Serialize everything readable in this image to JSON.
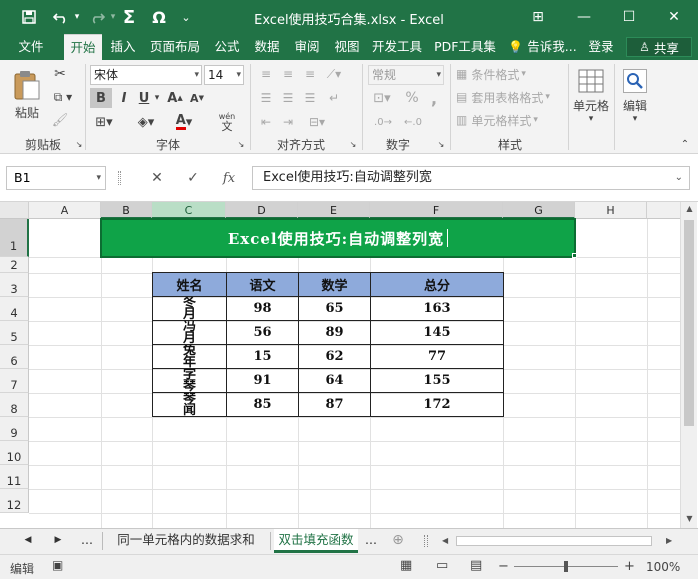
{
  "title_bar": {
    "title": "Excel使用技巧合集.xlsx - Excel",
    "save_icon": "save-icon",
    "undo_icon": "undo-icon",
    "redo_icon": "redo-icon",
    "sum_glyph": "Σ",
    "omega_glyph": "Ω",
    "customize_glyph": "⌄",
    "ribbon_display_glyph": "⊞",
    "minimize_glyph": "—",
    "maximize_glyph": "☐",
    "close_glyph": "✕"
  },
  "ribbon_tabs": [
    {
      "label": "文件"
    },
    {
      "label": "开始"
    },
    {
      "label": "插入"
    },
    {
      "label": "页面布局"
    },
    {
      "label": "公式"
    },
    {
      "label": "数据"
    },
    {
      "label": "审阅"
    },
    {
      "label": "视图"
    },
    {
      "label": "开发工具"
    },
    {
      "label": "PDF工具集"
    },
    {
      "label": "告诉我..."
    },
    {
      "label": "登录"
    },
    {
      "label": "共享"
    }
  ],
  "ribbon": {
    "clipboard": {
      "paste_label": "粘贴",
      "group_label": "剪贴板"
    },
    "font": {
      "font_name": "宋体",
      "font_size": "14",
      "bold": "B",
      "italic": "I",
      "underline": "U",
      "grow": "A",
      "shrink": "A",
      "color_a": "A",
      "wen": "wén",
      "wen_sub": "文",
      "group_label": "字体"
    },
    "alignment": {
      "group_label": "对齐方式"
    },
    "number": {
      "format": "常规",
      "currency": "%",
      "comma": ",",
      "group_label": "数字"
    },
    "styles": {
      "conditional": "条件格式",
      "table": "套用表格格式",
      "cell_styles": "单元格样式",
      "group_label": "样式"
    },
    "cells": {
      "label": "单元格"
    },
    "editing": {
      "label": "编辑"
    }
  },
  "formula_bar": {
    "name_box": "B1",
    "cancel_glyph": "✕",
    "enter_glyph": "✓",
    "fx_label": "fx",
    "content": "Excel使用技巧:自动调整列宽"
  },
  "columns": [
    "A",
    "B",
    "C",
    "D",
    "E",
    "F",
    "G",
    "H"
  ],
  "rows": [
    "1",
    "2",
    "3",
    "4",
    "5",
    "6",
    "7",
    "8",
    "9",
    "10",
    "11",
    "12"
  ],
  "sheet": {
    "merged_title": "Excel使用技巧:自动调整列宽",
    "table_headers": [
      "姓名",
      "语文",
      "数学",
      "总分"
    ],
    "table_rows": [
      {
        "name": "冬月",
        "chinese": "98",
        "math": "65",
        "total": "163"
      },
      {
        "name": "冯月",
        "chinese": "56",
        "math": "89",
        "total": "145"
      },
      {
        "name": "兔年",
        "chinese": "15",
        "math": "62",
        "total": "77"
      },
      {
        "name": "学琴",
        "chinese": "91",
        "math": "64",
        "total": "155"
      },
      {
        "name": "琴闻",
        "chinese": "85",
        "math": "87",
        "total": "172"
      }
    ]
  },
  "sheet_tabs": {
    "ellipsis_left": "...",
    "tab1": "同一单元格内的数据求和",
    "tab2": "双击填充函数",
    "ellipsis_right": "...",
    "add_glyph": "⊕"
  },
  "status_bar": {
    "mode": "编辑",
    "zoom": "100%",
    "zoom_minus": "−",
    "zoom_plus": "+"
  }
}
